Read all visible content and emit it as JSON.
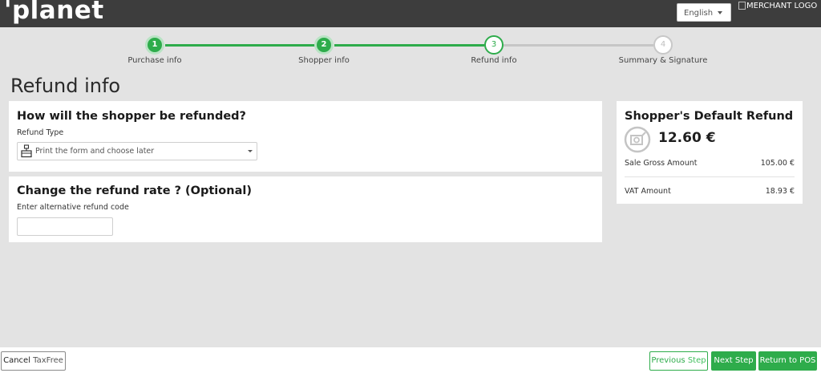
{
  "header": {
    "logo_text": "'planet",
    "language": "English",
    "merchant_logo_alt": "MERCHANT LOGO"
  },
  "stepper": {
    "steps": [
      {
        "number": "1",
        "label": "Purchase info",
        "state": "done"
      },
      {
        "number": "2",
        "label": "Shopper info",
        "state": "done"
      },
      {
        "number": "3",
        "label": "Refund info",
        "state": "active"
      },
      {
        "number": "4",
        "label": "Summary & Signature",
        "state": "todo"
      }
    ]
  },
  "page": {
    "title": "Refund info"
  },
  "refund_type_card": {
    "heading": "How will the shopper be refunded?",
    "field_label": "Refund Type",
    "selected_value": "Print the form and choose later",
    "icon": "printer-form-icon"
  },
  "rate_card": {
    "heading": "Change the refund rate ? (Optional)",
    "field_label": "Enter alternative refund code",
    "input_value": "",
    "input_placeholder": ""
  },
  "default_refund_card": {
    "heading": "Shopper's Default Refund",
    "icon": "refund-cycle-icon",
    "amount": "12.60 €",
    "rows": [
      {
        "label": "Sale Gross Amount",
        "value": "105.00 €"
      },
      {
        "label": "VAT Amount",
        "value": "18.93 €"
      }
    ]
  },
  "footer": {
    "cancel_main": "Cancel",
    "cancel_suffix": "TaxFree",
    "previous_main": "Previous",
    "previous_suffix": "Step",
    "next": "Next Step",
    "return": "Return to POS"
  },
  "colors": {
    "brand_green": "#2eac4b",
    "header_bg": "#3d3d3d",
    "page_bg": "#e3e3e3"
  }
}
